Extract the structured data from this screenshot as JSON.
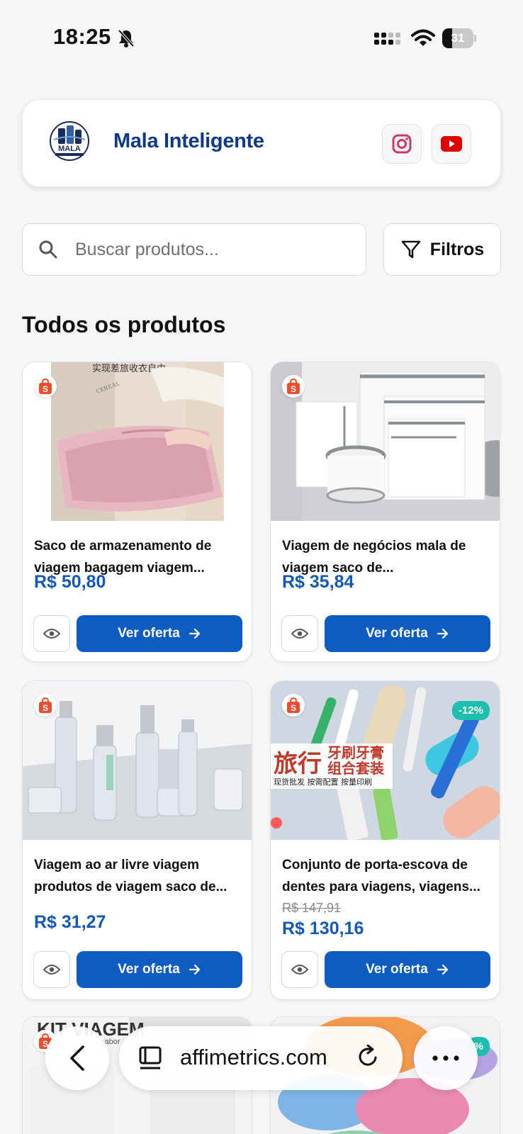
{
  "status_bar": {
    "time": "18:25",
    "battery_level": "31",
    "battery_fraction": 0.31,
    "icons": [
      "bell-muted-icon",
      "signal-icon",
      "wifi-icon",
      "battery-icon"
    ]
  },
  "header": {
    "logo_text": "MALA",
    "brand_name": "Mala Inteligente",
    "social": [
      {
        "name": "instagram",
        "icon": "instagram-icon",
        "color": "#d6336c"
      },
      {
        "name": "youtube",
        "icon": "youtube-icon",
        "color": "#e00000"
      }
    ]
  },
  "search": {
    "placeholder": "Buscar produtos...",
    "value": "",
    "filters_label": "Filtros"
  },
  "section_title": "Todos os produtos",
  "products": [
    {
      "name_line1": "Saco de armazenamento de",
      "name_line2": "viagem bagagem viagem...",
      "old_price": "",
      "price": "R$ 50,80",
      "discount": "",
      "cta": "Ver oferta",
      "image_text": "实现差旅收衣自由",
      "image_text_2": "CEREAL"
    },
    {
      "name_line1": "Viagem de negócios mala de",
      "name_line2": "viagem saco de...",
      "old_price": "",
      "price": "R$ 35,84",
      "discount": "",
      "cta": "Ver oferta"
    },
    {
      "name_line1": "Viagem ao ar livre viagem",
      "name_line2": "produtos de viagem saco de...",
      "old_price": "",
      "price": "R$ 31,27",
      "discount": "",
      "cta": "Ver oferta"
    },
    {
      "name_line1": "Conjunto de porta-escova de",
      "name_line2": "dentes para viagens, viagens...",
      "old_price": "R$ 147,91",
      "price": "R$ 130,16",
      "discount": "-12%",
      "cta": "Ver oferta",
      "image_text": "旅行",
      "image_text_2": "牙刷牙膏",
      "image_text_3": "组合套装",
      "image_text_4": "现货批发  按需配置  按量印刷"
    },
    {
      "image_text": "KIT VIAGEM",
      "image_text_2": "sabor"
    },
    {
      "discount": "%"
    }
  ],
  "browser": {
    "url": "affimetrics.com"
  },
  "colors": {
    "brand_blue": "#0d3a86",
    "price_blue": "#1258b8",
    "button_blue": "#0e5bc2",
    "shopee_orange": "#ee4d2d",
    "discount_teal": "#1fbfb0"
  }
}
